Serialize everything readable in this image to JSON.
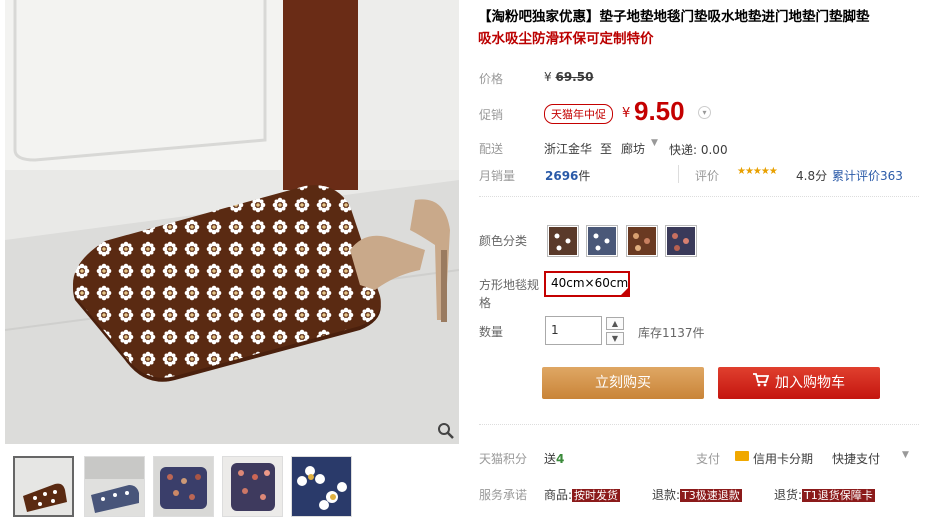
{
  "product": {
    "title_main": "【淘粉吧独家优惠】垫子地垫地毯门垫吸水地垫进门地垫门垫脚垫",
    "title_sub": "吸水吸尘防滑环保可定制特价"
  },
  "price": {
    "label": "价格",
    "currency": "¥",
    "original": "69.50"
  },
  "promo": {
    "label": "促销",
    "badge": "天猫年中促",
    "currency": "¥",
    "price": "9.50"
  },
  "shipping": {
    "label": "配送",
    "from": "浙江金华",
    "to_word": "至",
    "to": "廊坊",
    "express": "快递: 0.00"
  },
  "sales": {
    "label": "月销量",
    "count": "2696",
    "unit": "件",
    "rating_label": "评价",
    "stars": "★★★★★",
    "score": "4.8分",
    "reviews_label": "累计评价",
    "reviews": "363"
  },
  "color": {
    "label": "颜色分类",
    "swatches": [
      "brown-daisy",
      "blue-daisy",
      "brown-dots",
      "navy-dots"
    ]
  },
  "size": {
    "label": "方形地毯规格",
    "selected": "40cm×60cm"
  },
  "quantity": {
    "label": "数量",
    "value": "1",
    "stock": "库存1137件"
  },
  "buttons": {
    "buy": "立刻购买",
    "cart": "加入购物车"
  },
  "points": {
    "label": "天猫积分",
    "send": "送",
    "value": "4",
    "pay_label": "支付",
    "card": "信用卡分期",
    "quick": "快捷支付"
  },
  "service": {
    "label": "服务承诺",
    "goods": "商品:",
    "goods_tag": "按时发货",
    "refund": "退款:",
    "refund_tag": "T3极速退款",
    "return": "退货:",
    "return_tag": "T1退货保障卡"
  },
  "icons": {
    "zoom": "magnifier-icon",
    "cart": "cart-icon"
  },
  "colors": {
    "accent": "#c40000",
    "buy_button": "#d79a54",
    "cart_button": "#d3261a"
  }
}
